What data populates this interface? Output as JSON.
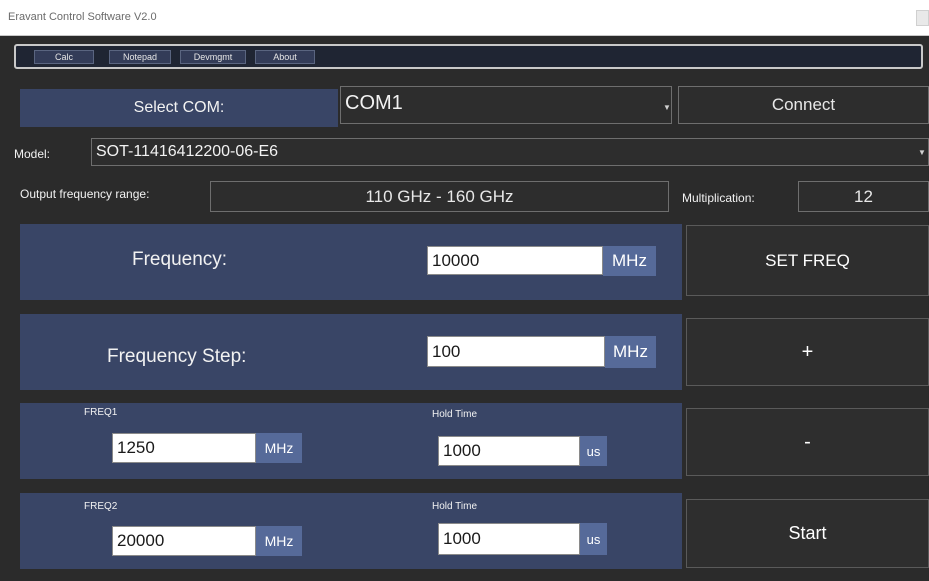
{
  "window": {
    "title": "Eravant Control Software V2.0"
  },
  "toolbar": {
    "buttons": [
      "Calc",
      "Notepad",
      "Devmgmt",
      "About"
    ]
  },
  "com": {
    "label": "Select COM:",
    "selected": "COM1",
    "connect_label": "Connect"
  },
  "model": {
    "label": "Model:",
    "selected": "SOT-11416412200-06-E6"
  },
  "output": {
    "label": "Output frequency range:",
    "value": "110 GHz - 160 GHz",
    "mult_label": "Multiplication:",
    "mult_value": "12"
  },
  "frequency": {
    "label": "Frequency:",
    "value": "10000",
    "unit": "MHz",
    "button": "SET FREQ"
  },
  "step": {
    "label": "Frequency Step:",
    "value": "100",
    "unit": "MHz",
    "button": "+"
  },
  "freq1": {
    "label": "FREQ1",
    "value": "1250",
    "unit": "MHz",
    "hold_label": "Hold Time",
    "hold_value": "1000",
    "hold_unit": "us",
    "button": "-"
  },
  "freq2": {
    "label": "FREQ2",
    "value": "20000",
    "unit": "MHz",
    "hold_label": "Hold Time",
    "hold_value": "1000",
    "hold_unit": "us",
    "button": "Start"
  },
  "colors": {
    "panel": "#394566",
    "background": "#2b2b2b",
    "unit_bg": "#566a99",
    "toolbar": "#1f2533"
  }
}
